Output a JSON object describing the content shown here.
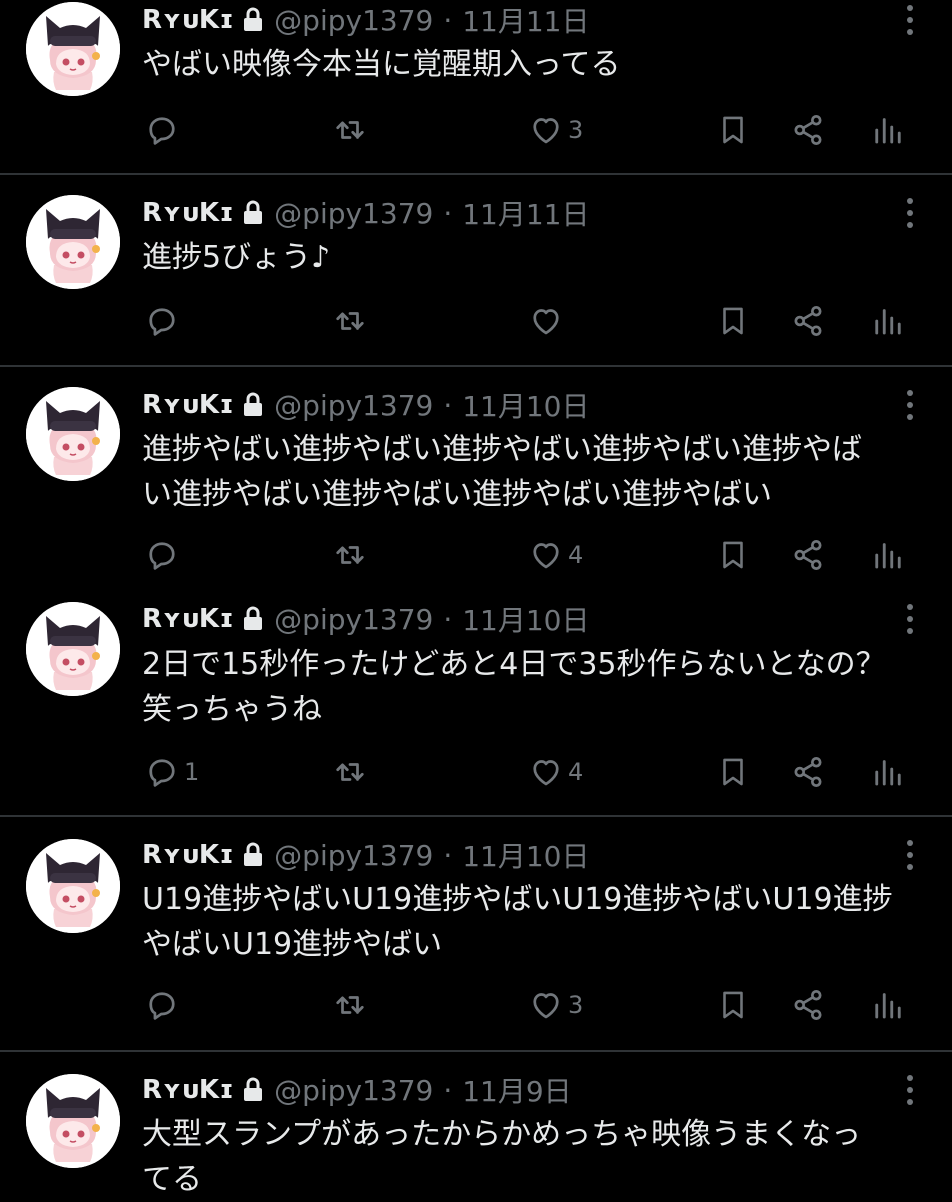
{
  "user": {
    "display_name": "RʏᴜKɪ",
    "handle": "@pipy1379",
    "separator": "·"
  },
  "colors": {
    "background": "#000000",
    "text": "#e7e9ea",
    "muted": "#71767b",
    "divider": "#2f3336"
  },
  "icons": {
    "reply": "reply-icon",
    "retweet": "retweet-icon",
    "like": "heart-icon",
    "bookmark": "bookmark-icon",
    "share": "share-icon",
    "views": "analytics-icon",
    "more": "more-icon",
    "lock": "lock-icon"
  },
  "tweets": [
    {
      "date": "11月11日",
      "text": "やばい映像今本当に覚醒期入ってる",
      "reply_count": "",
      "retweet_count": "",
      "like_count": "3"
    },
    {
      "date": "11月11日",
      "text": "進捗5びょう♪",
      "reply_count": "",
      "retweet_count": "",
      "like_count": ""
    },
    {
      "date": "11月10日",
      "text": "進捗やばい進捗やばい進捗やばい進捗やばい進捗やば\nい進捗やばい進捗やばい進捗やばい進捗やばい",
      "reply_count": "",
      "retweet_count": "",
      "like_count": "4"
    },
    {
      "date": "11月10日",
      "text": "2日で15秒作ったけどあと4日で35秒作らないとなの？\n笑っちゃうね",
      "reply_count": "1",
      "retweet_count": "",
      "like_count": "4"
    },
    {
      "date": "11月10日",
      "text": "U19進捗やばいU19進捗やばいU19進捗やばいU19進捗\nやばいU19進捗やばい",
      "reply_count": "",
      "retweet_count": "",
      "like_count": "3"
    },
    {
      "date": "11月9日",
      "text": "大型スランプがあったからかめっちゃ映像うまくなっ\nてる",
      "reply_count": "",
      "retweet_count": "",
      "like_count": ""
    }
  ]
}
